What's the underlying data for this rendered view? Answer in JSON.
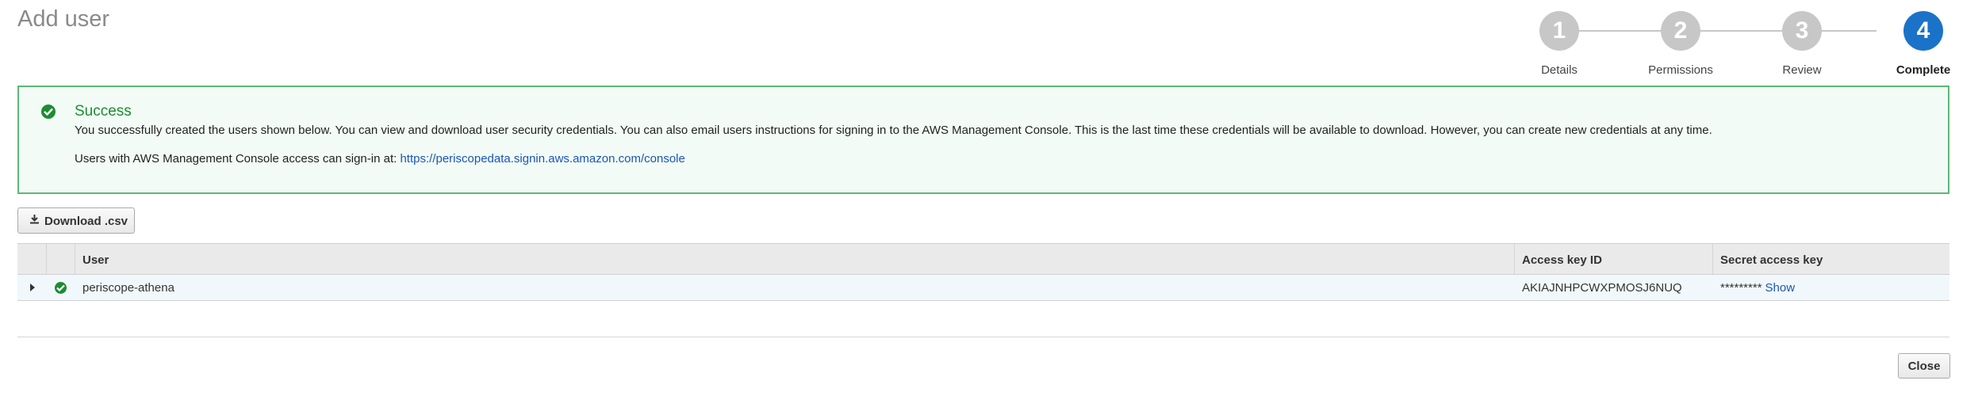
{
  "page": {
    "title": "Add user"
  },
  "wizard": {
    "steps": [
      {
        "number": "1",
        "label": "Details"
      },
      {
        "number": "2",
        "label": "Permissions"
      },
      {
        "number": "3",
        "label": "Review"
      },
      {
        "number": "4",
        "label": "Complete"
      }
    ],
    "active_step": 4,
    "active_color": "#1a73c8",
    "inactive_color": "#c7c7c7"
  },
  "alert": {
    "title": "Success",
    "message": "You successfully created the users shown below. You can view and download user security credentials. You can also email users instructions for signing in to the AWS Management Console. This is the last time these credentials will be available to download. However, you can create new credentials at any time.",
    "signin_prefix": "Users with AWS Management Console access can sign-in at: ",
    "signin_url": "https://periscopedata.signin.aws.amazon.com/console",
    "color": "#1d8c33"
  },
  "toolbar": {
    "download_label": "Download .csv"
  },
  "table": {
    "columns": [
      "User",
      "Access key ID",
      "Secret access key"
    ],
    "rows": [
      {
        "user": "periscope-athena",
        "access_key_id": "AKIAJNHPCWXPMOSJ6NUQ",
        "secret_masked": "*********",
        "show_label": "Show"
      }
    ]
  },
  "footer": {
    "close_label": "Close"
  }
}
